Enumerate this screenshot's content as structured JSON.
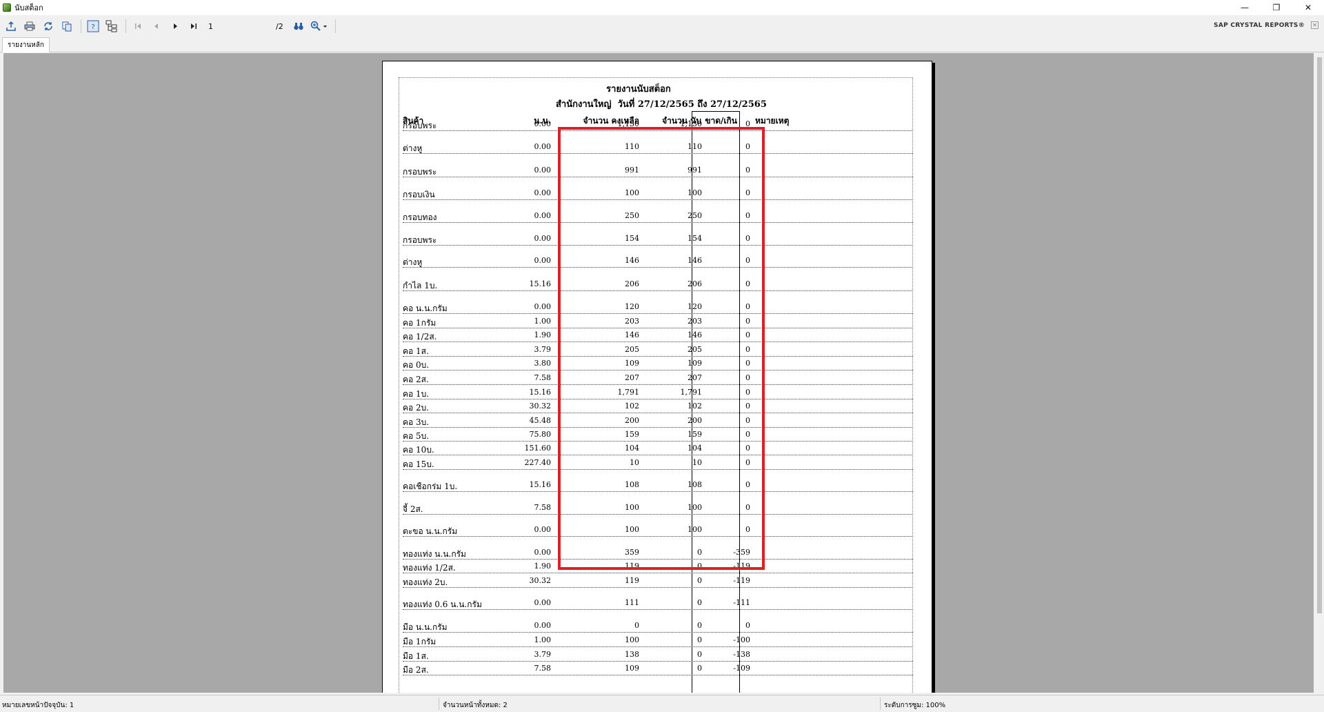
{
  "window": {
    "title": "นับสต็อก",
    "minimize_glyph": "—",
    "restore_glyph": "❐",
    "close_glyph": "✕"
  },
  "toolbar": {
    "icons": [
      "export-icon",
      "print-icon",
      "refresh-icon",
      "copy-icon",
      "help-icon",
      "group-tree-icon",
      "first-page-icon",
      "previous-page-icon",
      "next-page-icon",
      "last-page-icon",
      "find-icon",
      "zoom-icon"
    ],
    "current_page": "1",
    "total_pages": "/2",
    "brand": "SAP CRYSTAL REPORTS®"
  },
  "tabs": [
    {
      "label": "รายงานหลัก"
    }
  ],
  "report": {
    "title": "รายงานนับสต็อก",
    "subtitle_branch": "สำนักงานใหญ่",
    "subtitle_range": "วันที่ 27/12/2565 ถึง 27/12/2565",
    "headers": {
      "product": "สินค้า",
      "weight": "น.น.",
      "remaining": "จำนวน คงเหลือ",
      "counted": "จำนวน นับ",
      "diff": "ขาด/เกิน",
      "note": "หมายเหตุ"
    },
    "rows": [
      {
        "name": "กรอบพระ",
        "weight": "0.00",
        "remaining": "1,130",
        "counted": "1,130",
        "diff": "0"
      },
      {
        "name": "ต่างหู",
        "weight": "0.00",
        "remaining": "110",
        "counted": "110",
        "diff": "0"
      },
      {
        "name": "กรอบพระ",
        "weight": "0.00",
        "remaining": "991",
        "counted": "991",
        "diff": "0"
      },
      {
        "name": "กรอบเงิน",
        "weight": "0.00",
        "remaining": "100",
        "counted": "100",
        "diff": "0"
      },
      {
        "name": "กรอบทอง",
        "weight": "0.00",
        "remaining": "250",
        "counted": "250",
        "diff": "0"
      },
      {
        "name": "กรอบพระ",
        "weight": "0.00",
        "remaining": "154",
        "counted": "154",
        "diff": "0"
      },
      {
        "name": "ต่างหู",
        "weight": "0.00",
        "remaining": "146",
        "counted": "146",
        "diff": "0"
      },
      {
        "name": "กำไล 1บ.",
        "weight": "15.16",
        "remaining": "206",
        "counted": "206",
        "diff": "0"
      },
      {
        "name": "คอ น.น.กรัม",
        "weight": "0.00",
        "remaining": "120",
        "counted": "120",
        "diff": "0"
      },
      {
        "name": "คอ 1กรัม",
        "weight": "1.00",
        "remaining": "203",
        "counted": "203",
        "diff": "0"
      },
      {
        "name": "คอ 1/2ส.",
        "weight": "1.90",
        "remaining": "146",
        "counted": "146",
        "diff": "0"
      },
      {
        "name": "คอ 1ส.",
        "weight": "3.79",
        "remaining": "205",
        "counted": "205",
        "diff": "0"
      },
      {
        "name": "คอ 0บ.",
        "weight": "3.80",
        "remaining": "109",
        "counted": "109",
        "diff": "0"
      },
      {
        "name": "คอ 2ส.",
        "weight": "7.58",
        "remaining": "207",
        "counted": "207",
        "diff": "0"
      },
      {
        "name": "คอ 1บ.",
        "weight": "15.16",
        "remaining": "1,791",
        "counted": "1,791",
        "diff": "0"
      },
      {
        "name": "คอ 2บ.",
        "weight": "30.32",
        "remaining": "102",
        "counted": "102",
        "diff": "0"
      },
      {
        "name": "คอ 3บ.",
        "weight": "45.48",
        "remaining": "200",
        "counted": "200",
        "diff": "0"
      },
      {
        "name": "คอ 5บ.",
        "weight": "75.80",
        "remaining": "159",
        "counted": "159",
        "diff": "0"
      },
      {
        "name": "คอ 10บ.",
        "weight": "151.60",
        "remaining": "104",
        "counted": "104",
        "diff": "0"
      },
      {
        "name": "คอ 15บ.",
        "weight": "227.40",
        "remaining": "10",
        "counted": "10",
        "diff": "0"
      },
      {
        "name": "คอเชือกร่ม 1บ.",
        "weight": "15.16",
        "remaining": "108",
        "counted": "108",
        "diff": "0"
      },
      {
        "name": "จี้ 2ส.",
        "weight": "7.58",
        "remaining": "100",
        "counted": "100",
        "diff": "0"
      },
      {
        "name": "ตะขอ น.น.กรัม",
        "weight": "0.00",
        "remaining": "100",
        "counted": "100",
        "diff": "0"
      },
      {
        "name": "ทองแท่ง น.น.กรัม",
        "weight": "0.00",
        "remaining": "359",
        "counted": "0",
        "diff": "-359"
      },
      {
        "name": "ทองแท่ง 1/2ส.",
        "weight": "1.90",
        "remaining": "119",
        "counted": "0",
        "diff": "-119"
      },
      {
        "name": "ทองแท่ง 2บ.",
        "weight": "30.32",
        "remaining": "119",
        "counted": "0",
        "diff": "-119"
      },
      {
        "name": "ทองแท่ง 0.6 น.น.กรัม",
        "weight": "0.00",
        "remaining": "111",
        "counted": "0",
        "diff": "-111"
      },
      {
        "name": "มือ น.น.กรัม",
        "weight": "0.00",
        "remaining": "0",
        "counted": "0",
        "diff": "0"
      },
      {
        "name": "มือ 1กรัม",
        "weight": "1.00",
        "remaining": "100",
        "counted": "0",
        "diff": "-100"
      },
      {
        "name": "มือ 1ส.",
        "weight": "3.79",
        "remaining": "138",
        "counted": "0",
        "diff": "-138"
      },
      {
        "name": "มือ 2ส.",
        "weight": "7.58",
        "remaining": "109",
        "counted": "0",
        "diff": "-109"
      }
    ]
  },
  "status": {
    "current_page": "หมายเลขหน้าปัจจุบัน: 1",
    "total_pages": "จำนวนหน้าทั้งหมด: 2",
    "zoom": "ระดับการซูม: 100%"
  },
  "colors": {
    "highlight_border": "#d9202b",
    "viewer_background": "#a8a8a8"
  }
}
